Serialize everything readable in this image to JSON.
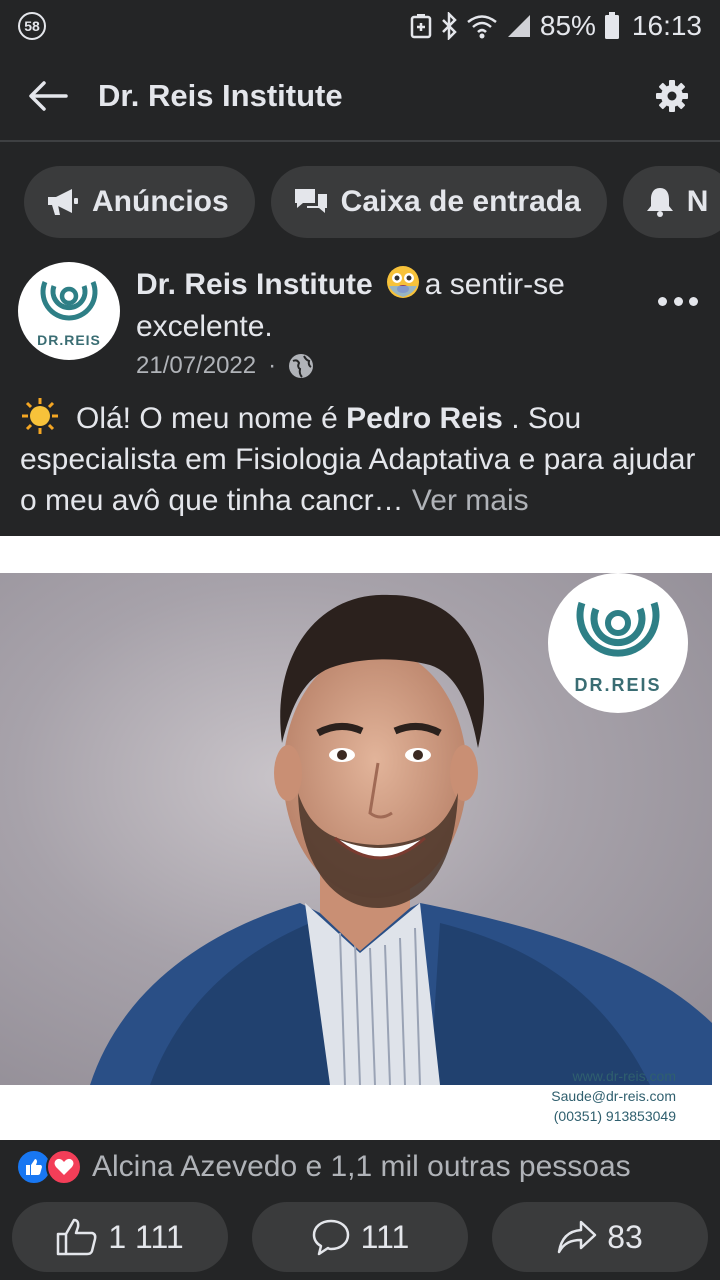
{
  "status_bar": {
    "notification_count": "58",
    "battery": "85%",
    "time": "16:13"
  },
  "app_bar": {
    "title": "Dr. Reis Institute"
  },
  "chips": [
    {
      "label": "Anúncios",
      "icon": "megaphone-icon"
    },
    {
      "label": "Caixa de entrada",
      "icon": "chat-icon"
    },
    {
      "label": "N",
      "icon": "bell-icon"
    }
  ],
  "post": {
    "avatar_text": "DR.REIS",
    "page_name": "Dr. Reis Institute",
    "feeling": "a sentir-se excelente.",
    "date": "21/07/2022",
    "separator": "·",
    "text_intro": "Olá! O meu nome é ",
    "text_name": "Pedro Reis",
    "text_rest": " . Sou especialista em Fisiologia Adaptativa e para ajudar o meu avô que tinha cancr…",
    "see_more": "Ver mais",
    "image": {
      "logo_text": "DR.REIS",
      "contact_website": "www.dr-reis.com",
      "contact_email": "Saude@dr-reis.com",
      "contact_phone": "(00351) 913853049"
    },
    "reactions_text": "Alcina Azevedo e 1,1 mil outras pessoas",
    "actions": {
      "like_count": "1 111",
      "comment_count": "111",
      "share_count": "83"
    }
  },
  "colors": {
    "background": "#242526",
    "chip": "#3a3b3c",
    "like_blue": "#1877f2",
    "love_red": "#f33e58",
    "logo_teal": "#2e7f86"
  }
}
